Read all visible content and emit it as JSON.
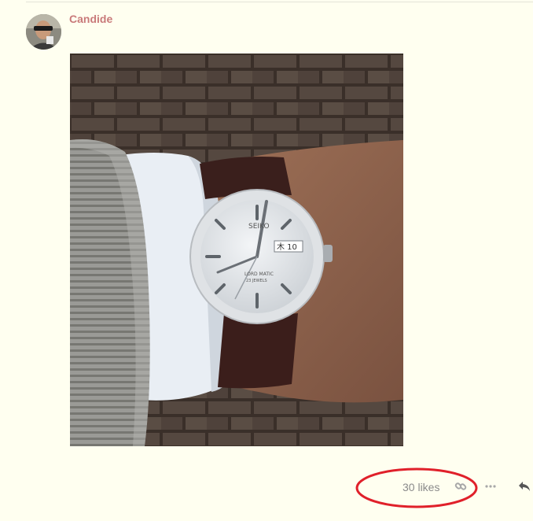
{
  "post": {
    "username": "Candide",
    "avatar_icon": "user-avatar",
    "image_icon": "wristwatch-photo"
  },
  "actions": {
    "likes_label": "30 likes",
    "link_icon": "link-icon",
    "more_icon": "more-icon",
    "reply_icon": "reply-icon"
  },
  "annotation": {
    "highlight_color": "#e0202a"
  },
  "watch_dial": {
    "brand": "SEIKO",
    "model": "LORD MATIC",
    "jewels": "23 JEWELS",
    "day": "木",
    "date": "10"
  }
}
